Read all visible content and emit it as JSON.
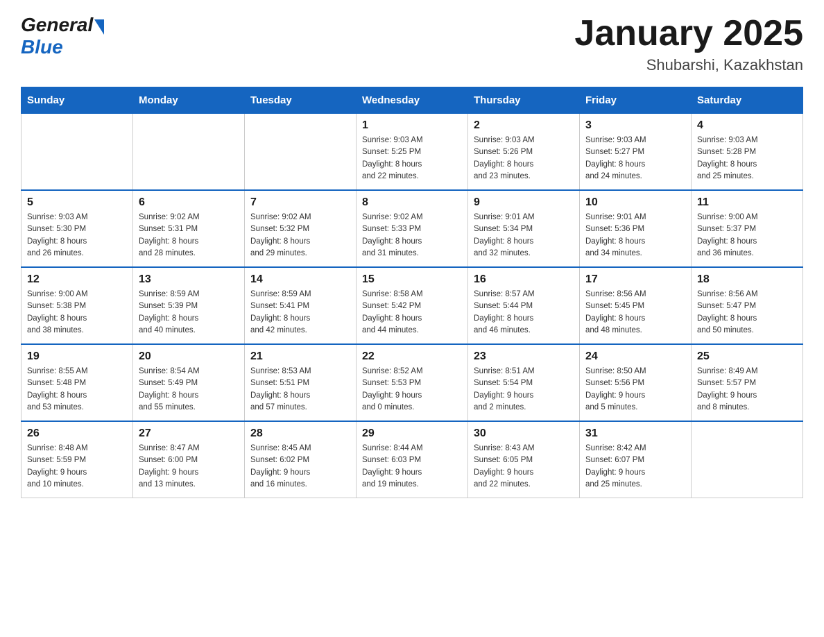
{
  "header": {
    "logo_general": "General",
    "logo_blue": "Blue",
    "title": "January 2025",
    "location": "Shubarshi, Kazakhstan"
  },
  "days_of_week": [
    "Sunday",
    "Monday",
    "Tuesday",
    "Wednesday",
    "Thursday",
    "Friday",
    "Saturday"
  ],
  "weeks": [
    [
      {
        "day": "",
        "info": ""
      },
      {
        "day": "",
        "info": ""
      },
      {
        "day": "",
        "info": ""
      },
      {
        "day": "1",
        "info": "Sunrise: 9:03 AM\nSunset: 5:25 PM\nDaylight: 8 hours\nand 22 minutes."
      },
      {
        "day": "2",
        "info": "Sunrise: 9:03 AM\nSunset: 5:26 PM\nDaylight: 8 hours\nand 23 minutes."
      },
      {
        "day": "3",
        "info": "Sunrise: 9:03 AM\nSunset: 5:27 PM\nDaylight: 8 hours\nand 24 minutes."
      },
      {
        "day": "4",
        "info": "Sunrise: 9:03 AM\nSunset: 5:28 PM\nDaylight: 8 hours\nand 25 minutes."
      }
    ],
    [
      {
        "day": "5",
        "info": "Sunrise: 9:03 AM\nSunset: 5:30 PM\nDaylight: 8 hours\nand 26 minutes."
      },
      {
        "day": "6",
        "info": "Sunrise: 9:02 AM\nSunset: 5:31 PM\nDaylight: 8 hours\nand 28 minutes."
      },
      {
        "day": "7",
        "info": "Sunrise: 9:02 AM\nSunset: 5:32 PM\nDaylight: 8 hours\nand 29 minutes."
      },
      {
        "day": "8",
        "info": "Sunrise: 9:02 AM\nSunset: 5:33 PM\nDaylight: 8 hours\nand 31 minutes."
      },
      {
        "day": "9",
        "info": "Sunrise: 9:01 AM\nSunset: 5:34 PM\nDaylight: 8 hours\nand 32 minutes."
      },
      {
        "day": "10",
        "info": "Sunrise: 9:01 AM\nSunset: 5:36 PM\nDaylight: 8 hours\nand 34 minutes."
      },
      {
        "day": "11",
        "info": "Sunrise: 9:00 AM\nSunset: 5:37 PM\nDaylight: 8 hours\nand 36 minutes."
      }
    ],
    [
      {
        "day": "12",
        "info": "Sunrise: 9:00 AM\nSunset: 5:38 PM\nDaylight: 8 hours\nand 38 minutes."
      },
      {
        "day": "13",
        "info": "Sunrise: 8:59 AM\nSunset: 5:39 PM\nDaylight: 8 hours\nand 40 minutes."
      },
      {
        "day": "14",
        "info": "Sunrise: 8:59 AM\nSunset: 5:41 PM\nDaylight: 8 hours\nand 42 minutes."
      },
      {
        "day": "15",
        "info": "Sunrise: 8:58 AM\nSunset: 5:42 PM\nDaylight: 8 hours\nand 44 minutes."
      },
      {
        "day": "16",
        "info": "Sunrise: 8:57 AM\nSunset: 5:44 PM\nDaylight: 8 hours\nand 46 minutes."
      },
      {
        "day": "17",
        "info": "Sunrise: 8:56 AM\nSunset: 5:45 PM\nDaylight: 8 hours\nand 48 minutes."
      },
      {
        "day": "18",
        "info": "Sunrise: 8:56 AM\nSunset: 5:47 PM\nDaylight: 8 hours\nand 50 minutes."
      }
    ],
    [
      {
        "day": "19",
        "info": "Sunrise: 8:55 AM\nSunset: 5:48 PM\nDaylight: 8 hours\nand 53 minutes."
      },
      {
        "day": "20",
        "info": "Sunrise: 8:54 AM\nSunset: 5:49 PM\nDaylight: 8 hours\nand 55 minutes."
      },
      {
        "day": "21",
        "info": "Sunrise: 8:53 AM\nSunset: 5:51 PM\nDaylight: 8 hours\nand 57 minutes."
      },
      {
        "day": "22",
        "info": "Sunrise: 8:52 AM\nSunset: 5:53 PM\nDaylight: 9 hours\nand 0 minutes."
      },
      {
        "day": "23",
        "info": "Sunrise: 8:51 AM\nSunset: 5:54 PM\nDaylight: 9 hours\nand 2 minutes."
      },
      {
        "day": "24",
        "info": "Sunrise: 8:50 AM\nSunset: 5:56 PM\nDaylight: 9 hours\nand 5 minutes."
      },
      {
        "day": "25",
        "info": "Sunrise: 8:49 AM\nSunset: 5:57 PM\nDaylight: 9 hours\nand 8 minutes."
      }
    ],
    [
      {
        "day": "26",
        "info": "Sunrise: 8:48 AM\nSunset: 5:59 PM\nDaylight: 9 hours\nand 10 minutes."
      },
      {
        "day": "27",
        "info": "Sunrise: 8:47 AM\nSunset: 6:00 PM\nDaylight: 9 hours\nand 13 minutes."
      },
      {
        "day": "28",
        "info": "Sunrise: 8:45 AM\nSunset: 6:02 PM\nDaylight: 9 hours\nand 16 minutes."
      },
      {
        "day": "29",
        "info": "Sunrise: 8:44 AM\nSunset: 6:03 PM\nDaylight: 9 hours\nand 19 minutes."
      },
      {
        "day": "30",
        "info": "Sunrise: 8:43 AM\nSunset: 6:05 PM\nDaylight: 9 hours\nand 22 minutes."
      },
      {
        "day": "31",
        "info": "Sunrise: 8:42 AM\nSunset: 6:07 PM\nDaylight: 9 hours\nand 25 minutes."
      },
      {
        "day": "",
        "info": ""
      }
    ]
  ]
}
